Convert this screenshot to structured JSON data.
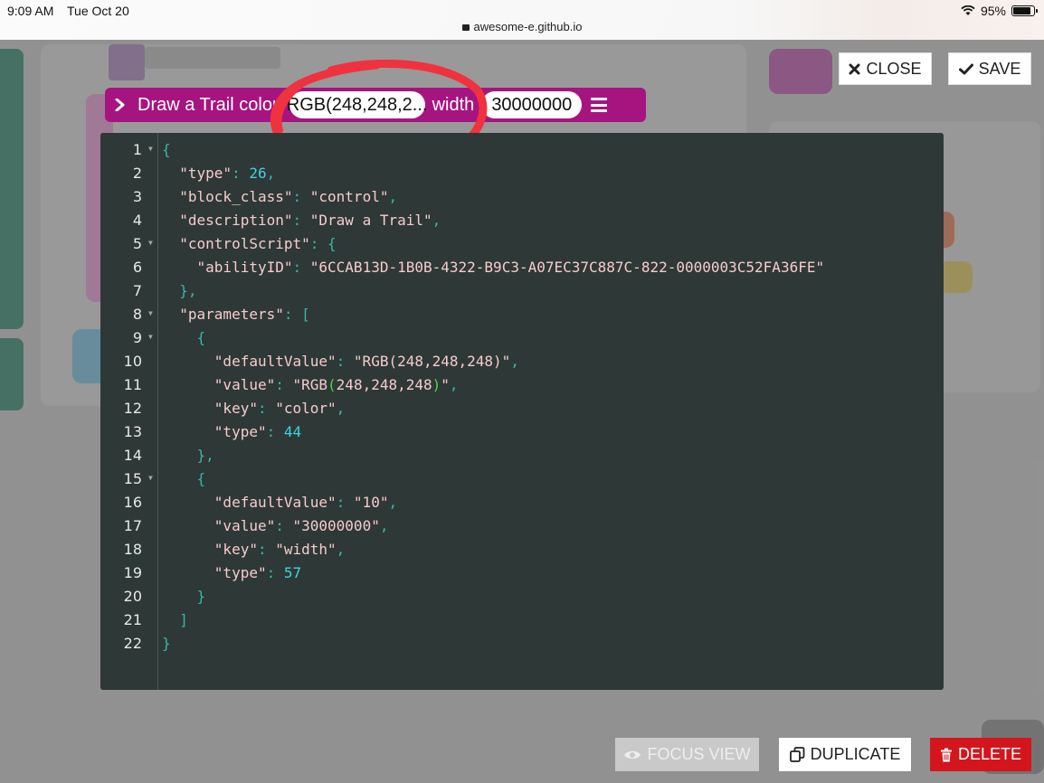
{
  "status_bar": {
    "time": "9:09 AM",
    "date": "Tue Oct 20",
    "url": "awesome-e.github.io",
    "battery": "95%"
  },
  "block": {
    "title": "Draw a Trail color",
    "color_value": "RGB(248,248,2...",
    "width_label": "width",
    "width_value": "30000000",
    "colors": {
      "block": "#a6157f",
      "highlight": "#f0323f"
    }
  },
  "buttons": {
    "close": "CLOSE",
    "save": "SAVE",
    "focus_view": "FOCUS VIEW",
    "duplicate": "DUPLICATE",
    "delete": "DELETE"
  },
  "editor": {
    "lines": [
      {
        "n": "1",
        "fold": true,
        "html": "<span class='p'>{</span>"
      },
      {
        "n": "2",
        "fold": false,
        "html": "  <span class='k'>\"type\"</span><span class='p'>: </span><span class='n'>26</span><span class='p'>,</span>"
      },
      {
        "n": "3",
        "fold": false,
        "html": "  <span class='k'>\"block_class\"</span><span class='p'>: </span><span class='s'>\"control\"</span><span class='p'>,</span>"
      },
      {
        "n": "4",
        "fold": false,
        "html": "  <span class='k'>\"description\"</span><span class='p'>: </span><span class='s'>\"Draw a Trail\"</span><span class='p'>,</span>"
      },
      {
        "n": "5",
        "fold": true,
        "html": "  <span class='k'>\"controlScript\"</span><span class='p'>: {</span>"
      },
      {
        "n": "6",
        "fold": false,
        "html": "    <span class='k'>\"abilityID\"</span><span class='p'>: </span><span class='s'>\"6CCAB13D-1B0B-4322-B9C3-A07EC37C887C-822-0000003C52FA36FE\"</span>"
      },
      {
        "n": "7",
        "fold": false,
        "html": "  <span class='p'>},</span>"
      },
      {
        "n": "8",
        "fold": true,
        "html": "  <span class='k'>\"parameters\"</span><span class='p'>: [</span>"
      },
      {
        "n": "9",
        "fold": true,
        "html": "    <span class='p'>{</span>"
      },
      {
        "n": "10",
        "fold": false,
        "html": "      <span class='k'>\"defaultValue\"</span><span class='p'>: </span><span class='s'>\"RGB(248,248,248)\"</span><span class='p'>,</span>"
      },
      {
        "n": "11",
        "fold": false,
        "html": "      <span class='k'>\"value\"</span><span class='p'>: </span><span class='s'>\"RGB</span><span class='pg'>(</span><span class='s'>248,248,248</span><span class='pg'>)</span><span class='s'>\"</span><span class='p'>,</span>"
      },
      {
        "n": "12",
        "fold": false,
        "html": "      <span class='k'>\"key\"</span><span class='p'>: </span><span class='s'>\"color\"</span><span class='p'>,</span>"
      },
      {
        "n": "13",
        "fold": false,
        "html": "      <span class='k'>\"type\"</span><span class='p'>: </span><span class='n'>44</span>"
      },
      {
        "n": "14",
        "fold": false,
        "html": "    <span class='p'>},</span>"
      },
      {
        "n": "15",
        "fold": true,
        "html": "    <span class='p'>{</span>"
      },
      {
        "n": "16",
        "fold": false,
        "html": "      <span class='k'>\"defaultValue\"</span><span class='p'>: </span><span class='s'>\"10\"</span><span class='p'>,</span>"
      },
      {
        "n": "17",
        "fold": false,
        "html": "      <span class='k'>\"value\"</span><span class='p'>: </span><span class='s'>\"30000000\"</span><span class='p'>,</span>"
      },
      {
        "n": "18",
        "fold": false,
        "html": "      <span class='k'>\"key\"</span><span class='p'>: </span><span class='s'>\"width\"</span><span class='p'>,</span>"
      },
      {
        "n": "19",
        "fold": false,
        "html": "      <span class='k'>\"type\"</span><span class='p'>: </span><span class='n'>57</span>"
      },
      {
        "n": "20",
        "fold": false,
        "html": "    <span class='p'>}</span>"
      },
      {
        "n": "21",
        "fold": false,
        "html": "  <span class='p'>]</span>"
      },
      {
        "n": "22",
        "fold": false,
        "html": "<span class='p'>}</span>"
      }
    ]
  }
}
